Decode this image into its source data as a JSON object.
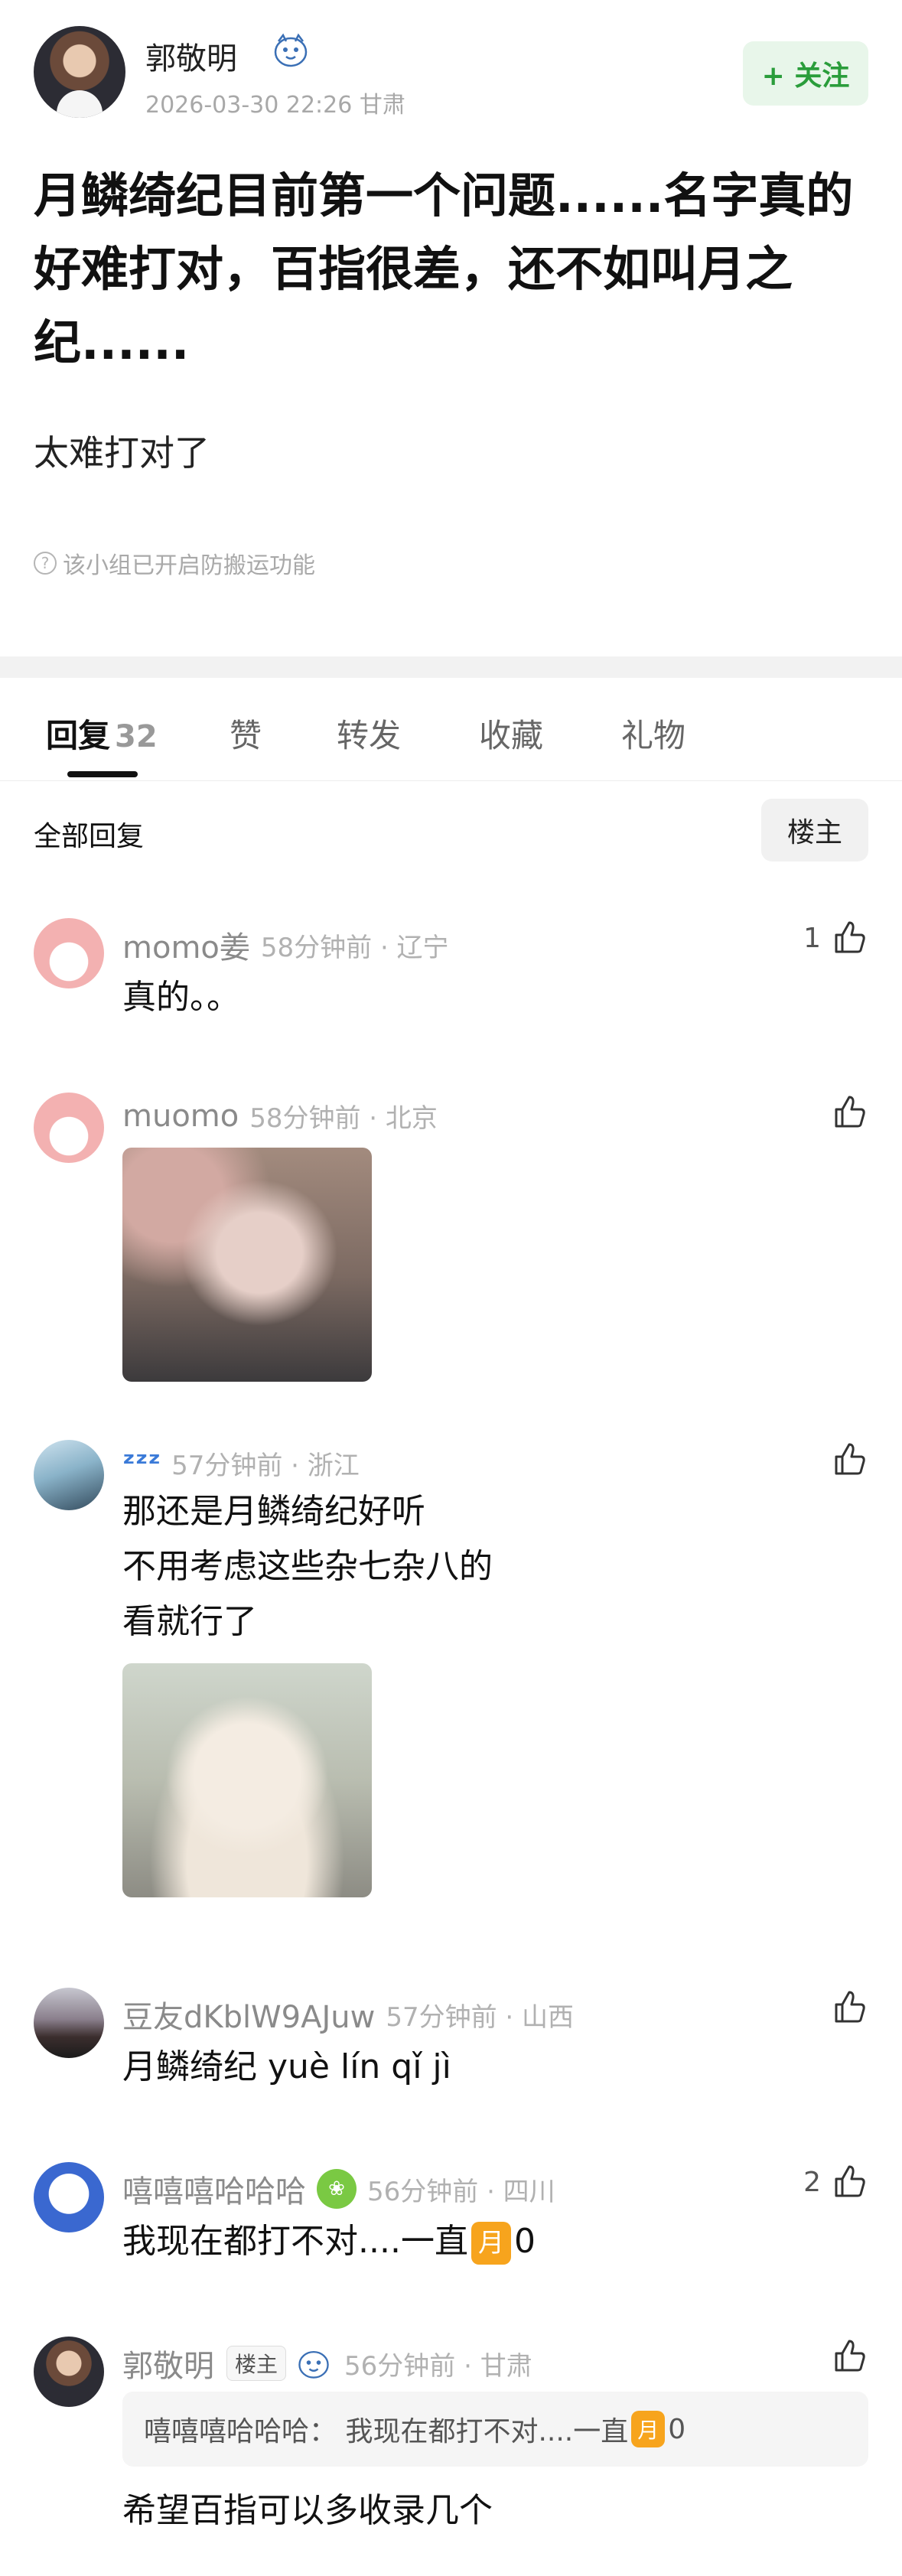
{
  "post": {
    "author": "郭敬明",
    "meta": "2026-03-30 22:26  甘肃",
    "follow_label": "+ 关注",
    "title": "月鳞绮纪目前第一个问题......名字真的好难打对，百指很差，还不如叫月之纪......",
    "body": "太难打对了",
    "anti_copy_notice": "该小组已开启防搬运功能"
  },
  "tabs": [
    {
      "label": "回复",
      "count": "32",
      "active": true
    },
    {
      "label": "赞"
    },
    {
      "label": "转发"
    },
    {
      "label": "收藏"
    },
    {
      "label": "礼物"
    }
  ],
  "filter": {
    "all_label": "全部回复",
    "op_label": "楼主"
  },
  "comments": [
    {
      "name": "momo姜",
      "time": "58分钟前 · 辽宁",
      "likes": "1",
      "lines": [
        "真的。。"
      ]
    },
    {
      "name": "muomo",
      "time": "58分钟前 · 北京",
      "likes": ""
    },
    {
      "name": "ᶻᶻᶻ",
      "time": "57分钟前 · 浙江",
      "likes": "",
      "lines": [
        "那还是月鳞绮纪好听",
        "不用考虑这些杂七杂八的",
        "看就行了"
      ]
    },
    {
      "name": "豆友dKblW9AJuw",
      "time": "57分钟前 · 山西",
      "likes": "",
      "lines": [
        "月鳞绮纪 yuè lín qǐ jì"
      ]
    },
    {
      "name": "嘻嘻嘻哈哈哈",
      "time": "56分钟前 · 四川",
      "likes": "2",
      "text_prefix": "我现在都打不对....一直",
      "text_suffix": "0"
    },
    {
      "name": "郭敬明",
      "op_tag": "楼主",
      "time": "56分钟前 · 甘肃",
      "likes": "",
      "quote_prefix": "嘻嘻嘻哈哈哈： 我现在都打不对....一直",
      "quote_suffix": "0",
      "lines": [
        "希望百指可以多收录几个"
      ]
    }
  ],
  "emoji": {
    "moon_char": "月"
  },
  "colors": {
    "follow_green": "#2a9d3b",
    "moon_orange": "#f7a41d",
    "separator": "#f2f2f2"
  }
}
